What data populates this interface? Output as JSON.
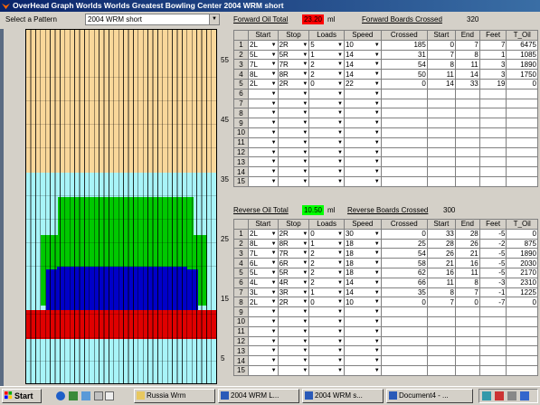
{
  "window": {
    "title": "OverHead Graph   Worlds Worlds Greatest Bowling Center    2004 WRM short"
  },
  "pattern": {
    "label": "Select a Pattern",
    "value": "2004 WRM short"
  },
  "forward": {
    "oil_label": "Forward Oil Total",
    "oil_value": "23.20",
    "unit": "ml",
    "boards_label": "Forward Boards Crossed",
    "boards_value": "320"
  },
  "reverse": {
    "oil_label": "Reverse Oil Total",
    "oil_value": "10.50",
    "unit": "ml",
    "boards_label": "Reverse Boards Crossed",
    "boards_value": "300"
  },
  "graph": {
    "y_labels": [
      "55",
      "45",
      "35",
      "25",
      "15",
      "5"
    ],
    "colors": {
      "tan": "#f9d79a",
      "cyan": "#a8f4f8",
      "green": "#00c800",
      "blue": "#0000c8",
      "red": "#e00000"
    }
  },
  "columns": [
    "Start",
    "Stop",
    "Loads",
    "Speed",
    "Crossed",
    "Start",
    "End",
    "Feet",
    "T_Oil"
  ],
  "forward_rows": [
    {
      "n": "1",
      "start": "2L",
      "stop": "2R",
      "loads": "5",
      "speed": "10",
      "crossed": "185",
      "s": "0",
      "e": "7",
      "feet": "7",
      "oil": "6475"
    },
    {
      "n": "2",
      "start": "5L",
      "stop": "5R",
      "loads": "1",
      "speed": "14",
      "crossed": "31",
      "s": "7",
      "e": "8",
      "feet": "1",
      "oil": "1085"
    },
    {
      "n": "3",
      "start": "7L",
      "stop": "7R",
      "loads": "2",
      "speed": "14",
      "crossed": "54",
      "s": "8",
      "e": "11",
      "feet": "3",
      "oil": "1890"
    },
    {
      "n": "4",
      "start": "8L",
      "stop": "8R",
      "loads": "2",
      "speed": "14",
      "crossed": "50",
      "s": "11",
      "e": "14",
      "feet": "3",
      "oil": "1750"
    },
    {
      "n": "5",
      "start": "2L",
      "stop": "2R",
      "loads": "0",
      "speed": "22",
      "crossed": "0",
      "s": "14",
      "e": "33",
      "feet": "19",
      "oil": "0"
    },
    {
      "n": "6"
    },
    {
      "n": "7"
    },
    {
      "n": "8"
    },
    {
      "n": "9"
    },
    {
      "n": "10"
    },
    {
      "n": "11"
    },
    {
      "n": "12"
    },
    {
      "n": "13"
    },
    {
      "n": "14"
    },
    {
      "n": "15"
    }
  ],
  "reverse_rows": [
    {
      "n": "1",
      "start": "2L",
      "stop": "2R",
      "loads": "0",
      "speed": "30",
      "crossed": "0",
      "s": "33",
      "e": "28",
      "feet": "-5",
      "oil": "0"
    },
    {
      "n": "2",
      "start": "8L",
      "stop": "8R",
      "loads": "1",
      "speed": "18",
      "crossed": "25",
      "s": "28",
      "e": "26",
      "feet": "-2",
      "oil": "875"
    },
    {
      "n": "3",
      "start": "7L",
      "stop": "7R",
      "loads": "2",
      "speed": "18",
      "crossed": "54",
      "s": "26",
      "e": "21",
      "feet": "-5",
      "oil": "1890"
    },
    {
      "n": "4",
      "start": "6L",
      "stop": "6R",
      "loads": "2",
      "speed": "18",
      "crossed": "58",
      "s": "21",
      "e": "16",
      "feet": "-5",
      "oil": "2030"
    },
    {
      "n": "5",
      "start": "5L",
      "stop": "5R",
      "loads": "2",
      "speed": "18",
      "crossed": "62",
      "s": "16",
      "e": "11",
      "feet": "-5",
      "oil": "2170"
    },
    {
      "n": "6",
      "start": "4L",
      "stop": "4R",
      "loads": "2",
      "speed": "14",
      "crossed": "66",
      "s": "11",
      "e": "8",
      "feet": "-3",
      "oil": "2310"
    },
    {
      "n": "7",
      "start": "3L",
      "stop": "3R",
      "loads": "1",
      "speed": "14",
      "crossed": "35",
      "s": "8",
      "e": "7",
      "feet": "-1",
      "oil": "1225"
    },
    {
      "n": "8",
      "start": "2L",
      "stop": "2R",
      "loads": "0",
      "speed": "10",
      "crossed": "0",
      "s": "7",
      "e": "0",
      "feet": "-7",
      "oil": "0"
    },
    {
      "n": "9"
    },
    {
      "n": "10"
    },
    {
      "n": "11"
    },
    {
      "n": "12"
    },
    {
      "n": "13"
    },
    {
      "n": "14"
    },
    {
      "n": "15"
    }
  ],
  "taskbar": {
    "start": "Start",
    "buttons": [
      "Russia Wrm",
      "2004 WRM L...",
      "2004 WRM s...",
      "Document4 - ..."
    ]
  }
}
